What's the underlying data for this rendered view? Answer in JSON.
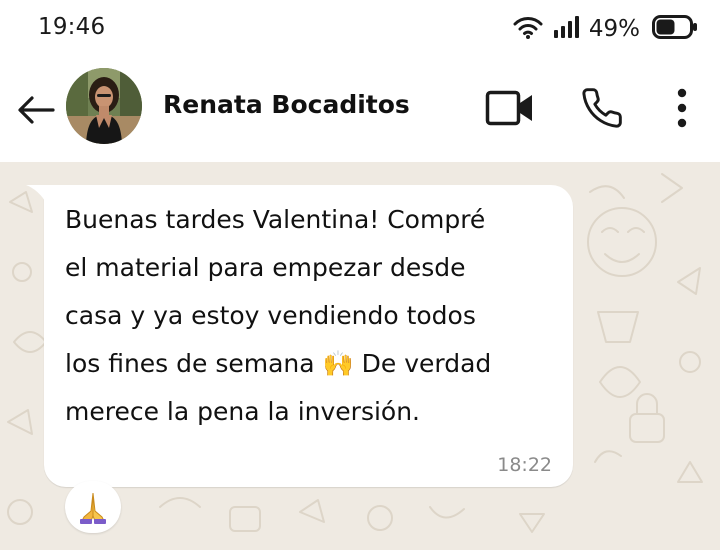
{
  "status_bar": {
    "time": "19:46",
    "battery_percent": "49%",
    "icons": [
      "wifi-icon",
      "signal-icon",
      "battery-icon"
    ]
  },
  "header": {
    "contact_name": "Renata Bocaditos",
    "icons": [
      "back-arrow-icon",
      "video-camera-icon",
      "phone-icon",
      "more-vertical-icon"
    ]
  },
  "message": {
    "text": "Buenas tardes Valentina! Compré\nel material para empezar desde\ncasa y ya estoy vendiendo todos\nlos fines de semana 🙌  De verdad\nmerece la pena la inversión.",
    "time": "18:22",
    "reaction": "🙏"
  },
  "colors": {
    "chat_background": "#efeae2",
    "bubble": "#ffffff",
    "timestamp": "#8a8a8a",
    "text": "#111111"
  }
}
